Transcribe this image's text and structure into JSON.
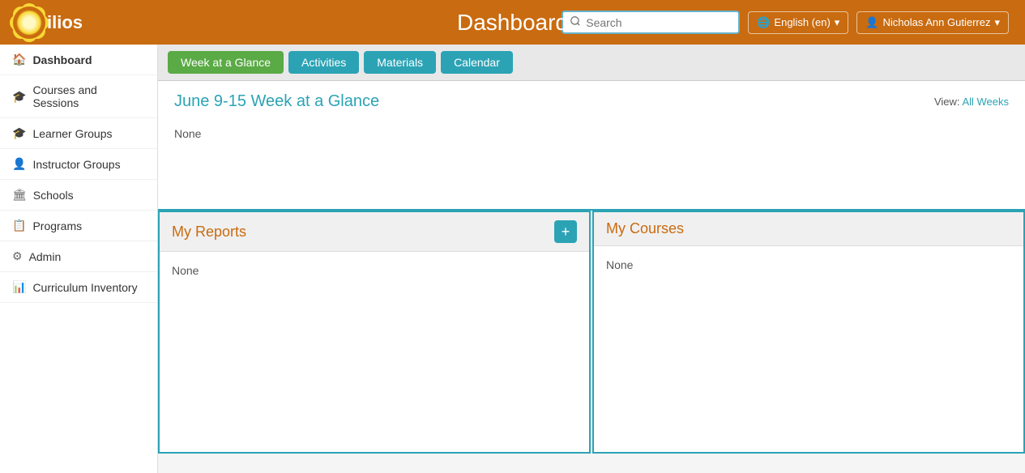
{
  "header": {
    "logo_text": "ilios",
    "title": "Dashboard",
    "search_placeholder": "Search",
    "lang_label": "English (en)",
    "user_label": "Nicholas Ann Gutierrez"
  },
  "sidebar": {
    "items": [
      {
        "id": "dashboard",
        "label": "Dashboard",
        "icon": "🏠",
        "active": true
      },
      {
        "id": "courses-sessions",
        "label": "Courses and Sessions",
        "icon": "🎓"
      },
      {
        "id": "learner-groups",
        "label": "Learner Groups",
        "icon": "🎓"
      },
      {
        "id": "instructor-groups",
        "label": "Instructor Groups",
        "icon": "👤"
      },
      {
        "id": "schools",
        "label": "Schools",
        "icon": "🏛"
      },
      {
        "id": "programs",
        "label": "Programs",
        "icon": "📋"
      },
      {
        "id": "admin",
        "label": "Admin",
        "icon": "⚙"
      },
      {
        "id": "curriculum-inventory",
        "label": "Curriculum Inventory",
        "icon": "📊"
      }
    ]
  },
  "tabs": [
    {
      "id": "week-at-a-glance",
      "label": "Week at a Glance",
      "active": true,
      "style": "green"
    },
    {
      "id": "activities",
      "label": "Activities",
      "style": "teal"
    },
    {
      "id": "materials",
      "label": "Materials",
      "style": "teal"
    },
    {
      "id": "calendar",
      "label": "Calendar",
      "style": "teal"
    }
  ],
  "week_section": {
    "title": "June 9-15 Week at a Glance",
    "view_prefix": "View:",
    "view_link_label": "All Weeks",
    "content": "None"
  },
  "my_reports": {
    "title": "My Reports",
    "add_label": "+",
    "content": "None"
  },
  "my_courses": {
    "title": "My Courses",
    "content": "None"
  }
}
